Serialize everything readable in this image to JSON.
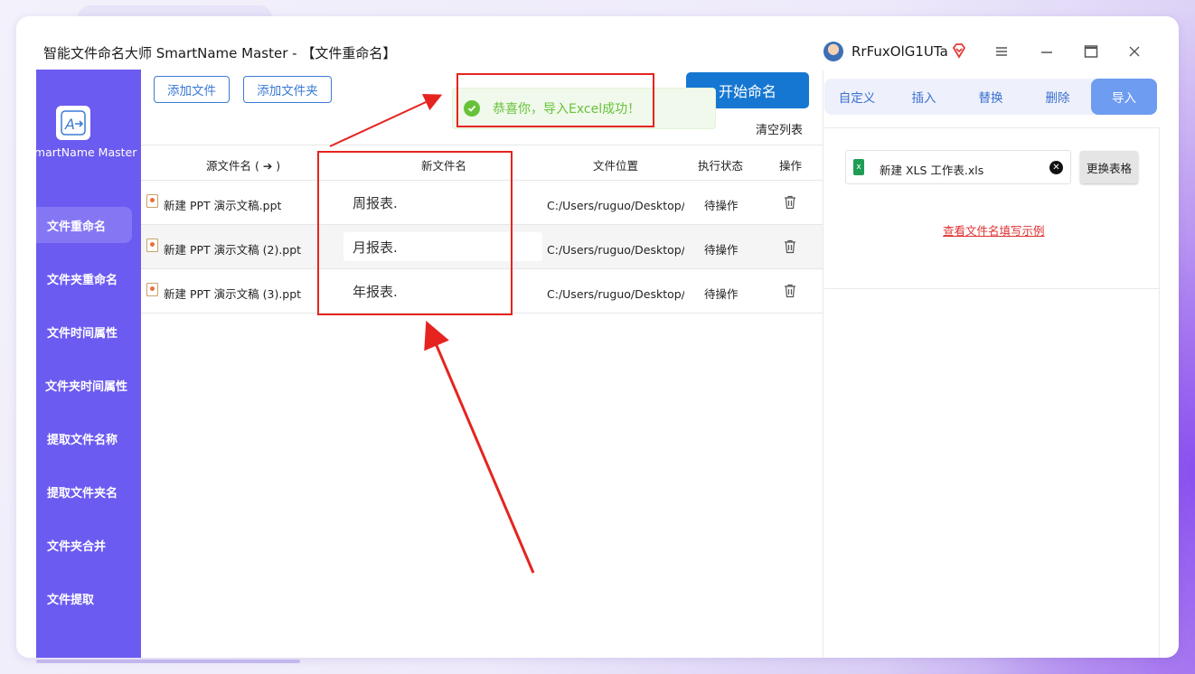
{
  "window": {
    "title": "智能文件命名大师 SmartName Master - 【文件重命名】",
    "username": "RrFuxOlG1UTa"
  },
  "sidebar": {
    "logo_text": "SmartName Master",
    "items": [
      {
        "label": "文件重命名",
        "active": true
      },
      {
        "label": "文件夹重命名"
      },
      {
        "label": "文件时间属性"
      },
      {
        "label": "文件夹时间属性"
      },
      {
        "label": "提取文件名称"
      },
      {
        "label": "提取文件夹名"
      },
      {
        "label": "文件夹合并"
      },
      {
        "label": "文件提取"
      }
    ]
  },
  "toolbar": {
    "add_file": "添加文件",
    "add_folder": "添加文件夹",
    "start": "开始命名",
    "clear_list": "清空列表"
  },
  "toast": {
    "message": "恭喜你，导入Excel成功！"
  },
  "table": {
    "headers": {
      "source": "源文件名 ( ➔ )",
      "new_name": "新文件名",
      "location": "文件位置",
      "status": "执行状态",
      "action": "操作"
    },
    "rows": [
      {
        "source": "新建 PPT 演示文稿.ppt",
        "new_name": "周报表.",
        "location": "C:/Users/ruguo/Desktop/新",
        "status": "待操作"
      },
      {
        "source": "新建 PPT 演示文稿 (2).ppt",
        "new_name": "月报表.",
        "location": "C:/Users/ruguo/Desktop/新",
        "status": "待操作"
      },
      {
        "source": "新建 PPT 演示文稿 (3).ppt",
        "new_name": "年报表.",
        "location": "C:/Users/ruguo/Desktop/新",
        "status": "待操作"
      }
    ]
  },
  "right_panel": {
    "tabs": [
      {
        "label": "自定义"
      },
      {
        "label": "插入"
      },
      {
        "label": "替换"
      },
      {
        "label": "删除"
      },
      {
        "label": "导入",
        "active": true
      }
    ],
    "xls_file": "新建 XLS 工作表.xls",
    "replace_table": "更换表格",
    "example_link": "查看文件名填写示例"
  },
  "colors": {
    "sidebar": "#6c5bf0",
    "primary": "#1677d2",
    "annotation": "#e52420",
    "success": "#67c23a"
  }
}
